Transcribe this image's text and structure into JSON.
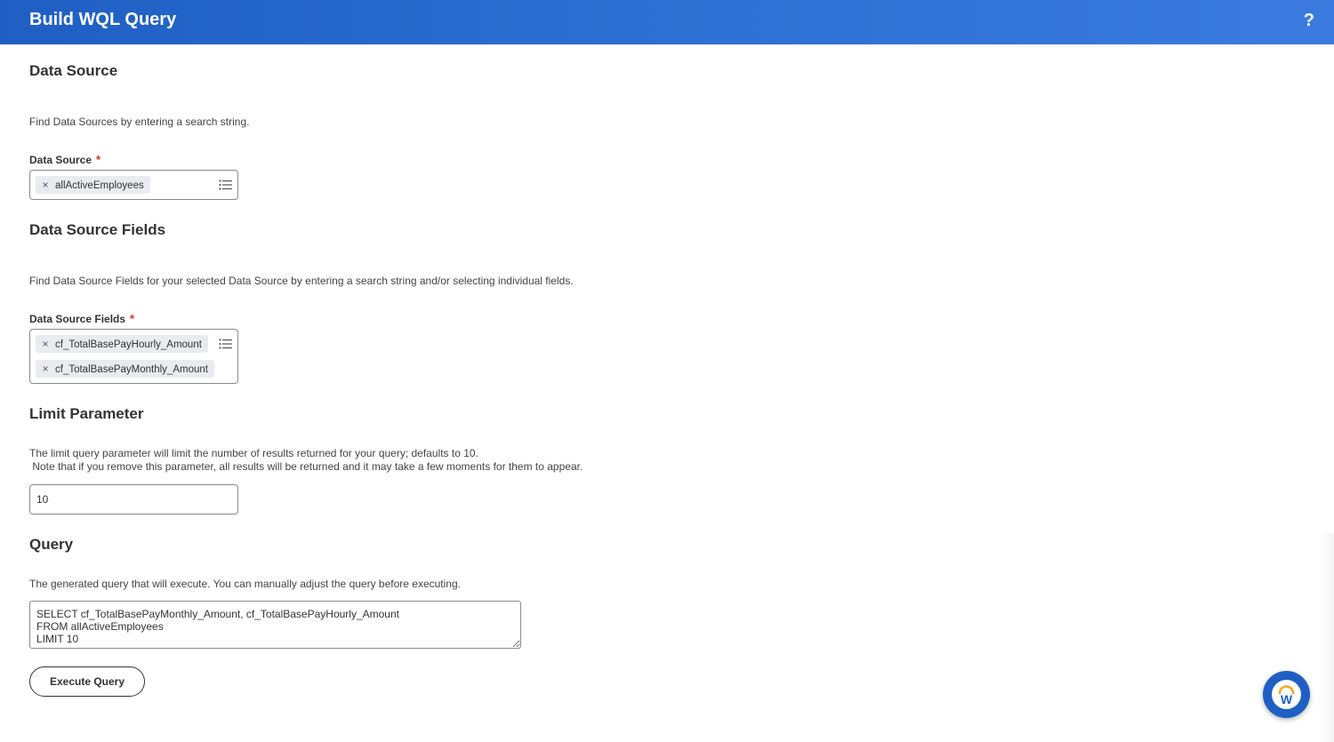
{
  "header": {
    "title": "Build WQL Query",
    "help_label": "?"
  },
  "data_source": {
    "title": "Data Source",
    "description": "Find Data Sources by entering a search string.",
    "field_label": "Data Source",
    "required_mark": "*",
    "selected": [
      "allActiveEmployees"
    ],
    "remove_glyph": "×",
    "list_icon": "list-icon"
  },
  "data_source_fields": {
    "title": "Data Source Fields",
    "description": "Find Data Source Fields for your selected Data Source by entering a search string and/or selecting individual fields.",
    "field_label": "Data Source Fields",
    "required_mark": "*",
    "selected": [
      "cf_TotalBasePayHourly_Amount",
      "cf_TotalBasePayMonthly_Amount"
    ],
    "remove_glyph": "×",
    "list_icon": "list-icon"
  },
  "limit_parameter": {
    "title": "Limit Parameter",
    "description_line1": "The limit query parameter will limit the number of results returned for your query; defaults to 10.",
    "description_line2": " Note that if you remove this parameter, all results will be returned and it may take a few moments for them to appear.",
    "value": "10"
  },
  "query": {
    "title": "Query",
    "description": "The generated query that will execute. You can manually adjust the query before executing.",
    "value": "SELECT cf_TotalBasePayMonthly_Amount, cf_TotalBasePayHourly_Amount\nFROM allActiveEmployees\nLIMIT 10",
    "execute_label": "Execute Query"
  },
  "assistant": {
    "icon": "workday-assistant-icon",
    "letter": "W"
  },
  "colors": {
    "header": "#2d6fd2",
    "required": "#de2e21",
    "chip": "#e9ebee",
    "assistant_ring": "#f5a623"
  }
}
